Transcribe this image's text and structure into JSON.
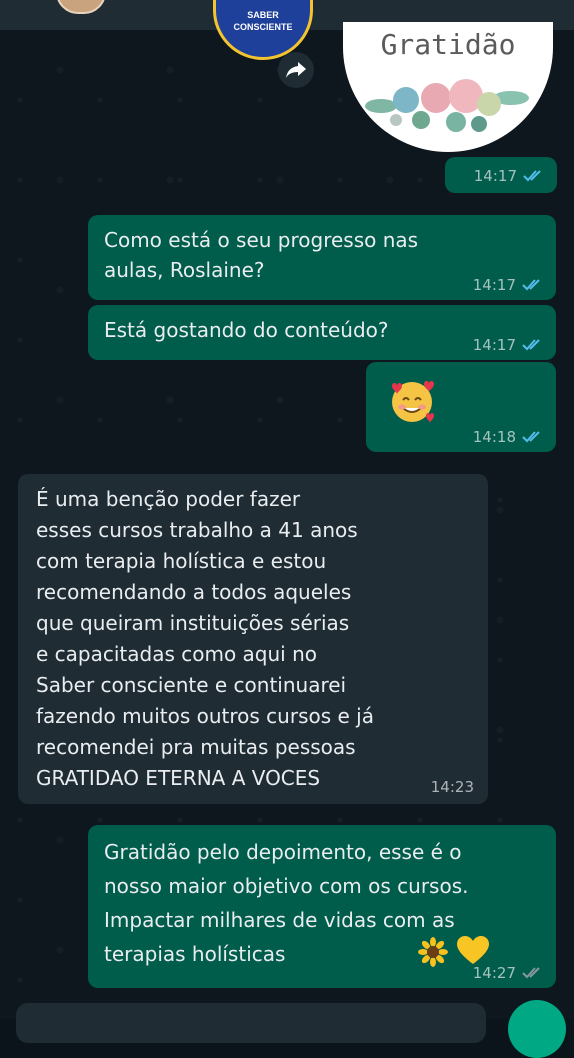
{
  "header": {
    "badge_line1": "SABER",
    "badge_line2": "CONSCIENTE"
  },
  "messages": [
    {
      "type": "image",
      "direction": "outgoing",
      "image_text": "Gratidão",
      "time": "14:17",
      "status": "read"
    },
    {
      "type": "text",
      "direction": "outgoing",
      "text": "Como está o seu progresso nas\naulas, Roslaine?",
      "time": "14:17",
      "status": "read"
    },
    {
      "type": "text",
      "direction": "outgoing",
      "text": "Está gostando do conteúdo?",
      "time": "14:17",
      "status": "read"
    },
    {
      "type": "emoji",
      "direction": "outgoing",
      "emoji": "smiling-face-with-hearts",
      "time": "14:18",
      "status": "read"
    },
    {
      "type": "text",
      "direction": "incoming",
      "text": "É  uma benção  poder fazer\nesses cursos trabalho a 41 anos\ncom terapia holística e estou\nrecomendando a todos aqueles\nque queiram instituições  sérias\ne capacitadas como aqui no\nSaber consciente e continuarei\nfazendo muitos outros cursos e já\nrecomendei pra muitas pessoas\nGRATIDAO ETERNA A VOCES",
      "time": "14:23"
    },
    {
      "type": "text",
      "direction": "outgoing",
      "text": "Gratidão pelo depoimento, esse é o\nnosso maior objetivo com os cursos.\nImpactar milhares de vidas com as\nterapias holísticas",
      "emojis": [
        "sunflower",
        "yellow-heart"
      ],
      "time": "14:27",
      "status": "delivered"
    }
  ],
  "colors": {
    "outgoing_bubble": "#005c4b",
    "incoming_bubble": "#1f2c34",
    "read_tick": "#53bdeb",
    "delivered_tick": "#8696a0"
  }
}
